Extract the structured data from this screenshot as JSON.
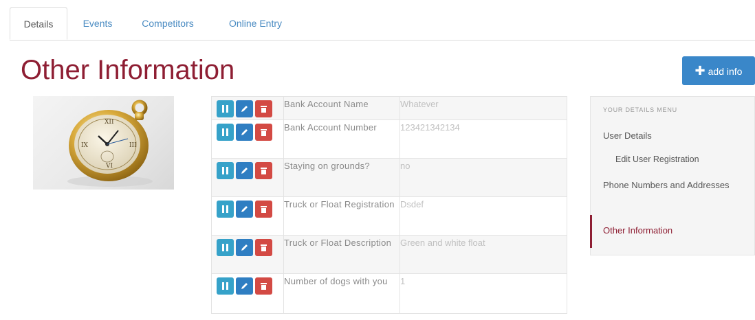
{
  "tabs": [
    {
      "label": "Details",
      "active": true
    },
    {
      "label": "Events",
      "active": false
    },
    {
      "label": "Competitors",
      "active": false
    },
    {
      "label": "Online Entry",
      "active": false
    }
  ],
  "page_title": "Other Information",
  "add_button": {
    "icon": "plus-icon",
    "label": "add info",
    "color": "#3a87c9"
  },
  "image": {
    "subject": "gold pocket watch"
  },
  "rows": [
    {
      "label": "Bank Account Name",
      "value": "Whatever"
    },
    {
      "label": "Bank Account Number",
      "value": "123421342134"
    },
    {
      "label": "Staying on grounds?",
      "value": "no"
    },
    {
      "label": "Truck or Float Registration",
      "value": "Dsdef"
    },
    {
      "label": "Truck or Float Description",
      "value": "Green and white float"
    },
    {
      "label": "Number of dogs with you",
      "value": "1"
    }
  ],
  "row_actions": {
    "move_icon": "move-icon",
    "edit_icon": "pencil-icon",
    "delete_icon": "trash-icon",
    "colors": {
      "move": "#36a2c9",
      "edit": "#2f7ec2",
      "delete": "#d34a44"
    }
  },
  "side_menu": {
    "heading": "YOUR DETAILS MENU",
    "items": [
      {
        "label": "User Details",
        "level": 1
      },
      {
        "label": "Edit User Registration",
        "level": 2
      },
      {
        "label": "Phone Numbers and Addresses",
        "level": 1
      },
      {
        "label": "Other Information",
        "level": 1,
        "active": true
      }
    ]
  },
  "colors": {
    "accent": "#8e1e33",
    "link": "#4a8bc2"
  }
}
